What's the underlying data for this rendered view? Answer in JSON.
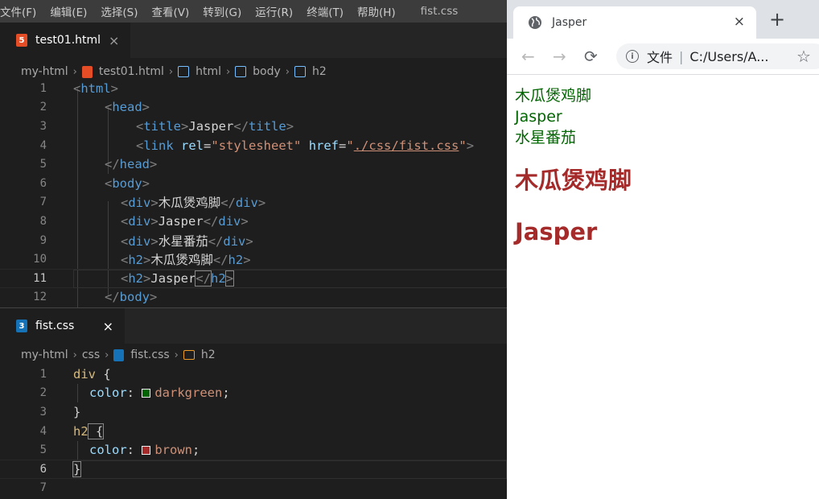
{
  "menubar": {
    "items": [
      "文件(F)",
      "编辑(E)",
      "选择(S)",
      "查看(V)",
      "转到(G)",
      "运行(R)",
      "终端(T)",
      "帮助(H)"
    ],
    "title": "fist.css"
  },
  "editor_top": {
    "tab": {
      "label": "test01.html",
      "icon_label": "5",
      "close": "×"
    },
    "breadcrumb": [
      "my-html",
      "test01.html",
      "html",
      "body",
      "h2"
    ],
    "line_numbers": [
      "1",
      "2",
      "3",
      "4",
      "5",
      "6",
      "7",
      "8",
      "9",
      "10",
      "11",
      "12"
    ],
    "active_line": "11",
    "code": {
      "l1": {
        "lt": "<",
        "tag": "html",
        "gt": ">"
      },
      "l2": {
        "lt": "<",
        "tag": "head",
        "gt": ">"
      },
      "l3": {
        "lt": "<",
        "tag": "title",
        "gt": ">",
        "text": "Jasper",
        "lt2": "</",
        "tag2": "title",
        "gt2": ">"
      },
      "l4": {
        "lt": "<",
        "tag": "link",
        "attr1": "rel",
        "eq1": "=",
        "val1": "\"stylesheet\"",
        "attr2": "href",
        "eq2": "=",
        "q1": "\"",
        "val2": "./css/fist.css",
        "q2": "\"",
        "gt": ">"
      },
      "l5": {
        "lt": "</",
        "tag": "head",
        "gt": ">"
      },
      "l6": {
        "lt": "<",
        "tag": "body",
        "gt": ">"
      },
      "l7": {
        "lt": "<",
        "tag": "div",
        "gt": ">",
        "text": "木瓜煲鸡脚",
        "lt2": "</",
        "tag2": "div",
        "gt2": ">"
      },
      "l8": {
        "lt": "<",
        "tag": "div",
        "gt": ">",
        "text": "Jasper",
        "lt2": "</",
        "tag2": "div",
        "gt2": ">"
      },
      "l9": {
        "lt": "<",
        "tag": "div",
        "gt": ">",
        "text": "水星番茄",
        "lt2": "</",
        "tag2": "div",
        "gt2": ">"
      },
      "l10": {
        "lt": "<",
        "tag": "h2",
        "gt": ">",
        "text": "木瓜煲鸡脚",
        "lt2": "</",
        "tag2": "h2",
        "gt2": ">"
      },
      "l11": {
        "lt": "<",
        "tag": "h2",
        "gt": ">",
        "text": "Jasper",
        "lt2": "</",
        "tag2": "h2",
        "gt2": ">"
      },
      "l12": {
        "lt": "</",
        "tag": "body",
        "gt": ">"
      }
    }
  },
  "editor_bottom": {
    "tab": {
      "label": "fist.css",
      "icon_label": "3",
      "close": "×"
    },
    "breadcrumb": [
      "my-html",
      "css",
      "fist.css",
      "h2"
    ],
    "line_numbers": [
      "1",
      "2",
      "3",
      "4",
      "5",
      "6",
      "7"
    ],
    "active_line": "6",
    "code": {
      "l1": {
        "sel": "div",
        "brace": " {"
      },
      "l2": {
        "prop": "color",
        "colon": ": ",
        "val": "darkgreen",
        "semi": ";"
      },
      "l3": {
        "brace": "}"
      },
      "l4": {
        "sel": "h2",
        "brace": " {"
      },
      "l5": {
        "prop": "color",
        "colon": ": ",
        "val": "brown",
        "semi": ";"
      },
      "l6": {
        "brace": "}"
      }
    },
    "swatch_colors": {
      "darkgreen": "#006400",
      "brown": "#a52a2a"
    }
  },
  "browser": {
    "tab_title": "Jasper",
    "tab_close": "×",
    "new_tab": "+",
    "nav": {
      "back": "←",
      "forward": "→",
      "reload": "⟳"
    },
    "omnibox": {
      "info": "i",
      "label": "文件",
      "pipe": "|",
      "url": "C:/Users/A..."
    },
    "star": "☆",
    "page": {
      "divs": [
        "木瓜煲鸡脚",
        "Jasper",
        "水星番茄"
      ],
      "h2s": [
        "木瓜煲鸡脚",
        "Jasper"
      ]
    }
  }
}
